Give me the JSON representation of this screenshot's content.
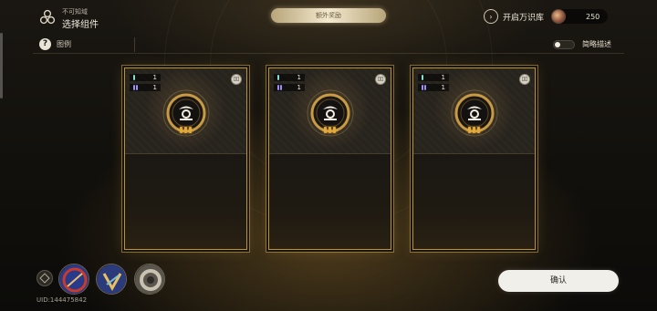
{
  "header": {
    "section_subtitle": "不可知域",
    "page_title": "选择组件",
    "tab_label": "额外奖励",
    "open_library_label": "开启万识库",
    "currency_value": "250"
  },
  "subbar": {
    "legend_label": "图例",
    "toggle_label": "简略描述",
    "toggle_on": false
  },
  "cards": [
    {
      "stat1": "1",
      "stat2": "1",
      "stat1_color": "#7fe0d0",
      "stat2_color": "#9f8cf5"
    },
    {
      "stat1": "1",
      "stat2": "1",
      "stat1_color": "#7fe0d0",
      "stat2_color": "#9f8cf5"
    },
    {
      "stat1": "1",
      "stat2": "1",
      "stat1_color": "#7fe0d0",
      "stat2_color": "#9f8cf5"
    }
  ],
  "footer": {
    "uid": "UID:144475842",
    "confirm_label": "确认"
  },
  "colors": {
    "card_border": "#b8923f",
    "accent_gold": "#e3a93b",
    "confirm_bg": "#f1efe9"
  },
  "icons": {
    "logo": "trefoil-logo-icon",
    "open_library": "chevron-right-circle-icon",
    "help": "question-circle-icon",
    "card_badge": "book-icon",
    "card_emblem": "path-emblem-icon"
  }
}
